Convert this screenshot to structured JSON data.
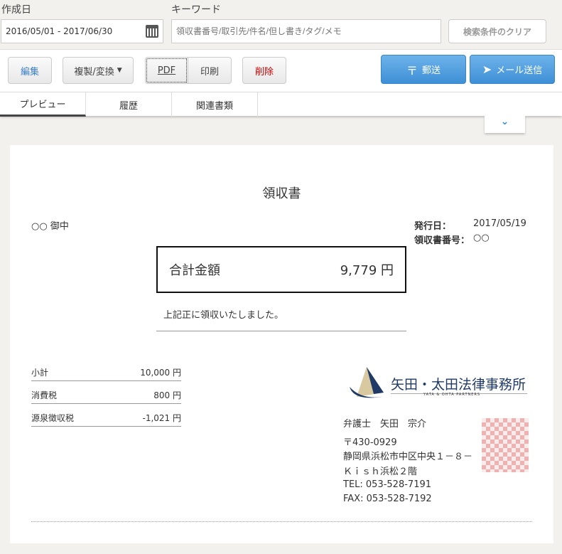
{
  "search": {
    "date_label": "作成日",
    "date_value": "2016/05/01 - 2017/06/30",
    "keyword_label": "キーワード",
    "keyword_placeholder": "領収書番号/取引先/件名/但し書き/タグ/メモ",
    "clear_label": "検索条件のクリア"
  },
  "toolbar": {
    "edit": "編集",
    "duplicate": "複製/変換",
    "pdf": "PDF",
    "print": "印刷",
    "delete": "削除",
    "mail_post": "郵送",
    "email_send": "メール送信"
  },
  "tabs": [
    {
      "label": "プレビュー",
      "active": true
    },
    {
      "label": "履歴"
    },
    {
      "label": "関連書類"
    }
  ],
  "doc": {
    "title": "領収書",
    "recipient": "○○ 御中",
    "issue_label": "発行日：",
    "issue_date": "2017/05/19",
    "number_label": "領収書番号：",
    "number_value": "○○",
    "total_label": "合計金額",
    "total_value": "9,779 円",
    "received_text": "上記正に領収いたしました。",
    "summary": [
      {
        "label": "小計",
        "value": "10,000 円"
      },
      {
        "label": "消費税",
        "value": "800 円"
      },
      {
        "label": "源泉徴収税",
        "value": "-1,021 円"
      }
    ],
    "firm_name": "矢田・太田法律事務所",
    "firm_name_en": "YATA & OHTA PARTNERS",
    "lawyer": "弁護士　矢田　宗介",
    "postal": "〒430-0929",
    "address1": "静岡県浜松市中区中央１－８－",
    "address2": "Ｋｉｓｈ浜松２階",
    "tel": "TEL: 053-528-7191",
    "fax": "FAX: 053-528-7192"
  },
  "colors": {
    "accent_blue": "#3e8fd6",
    "delete_red": "#cc0000",
    "logo_navy": "#1f3a66"
  }
}
